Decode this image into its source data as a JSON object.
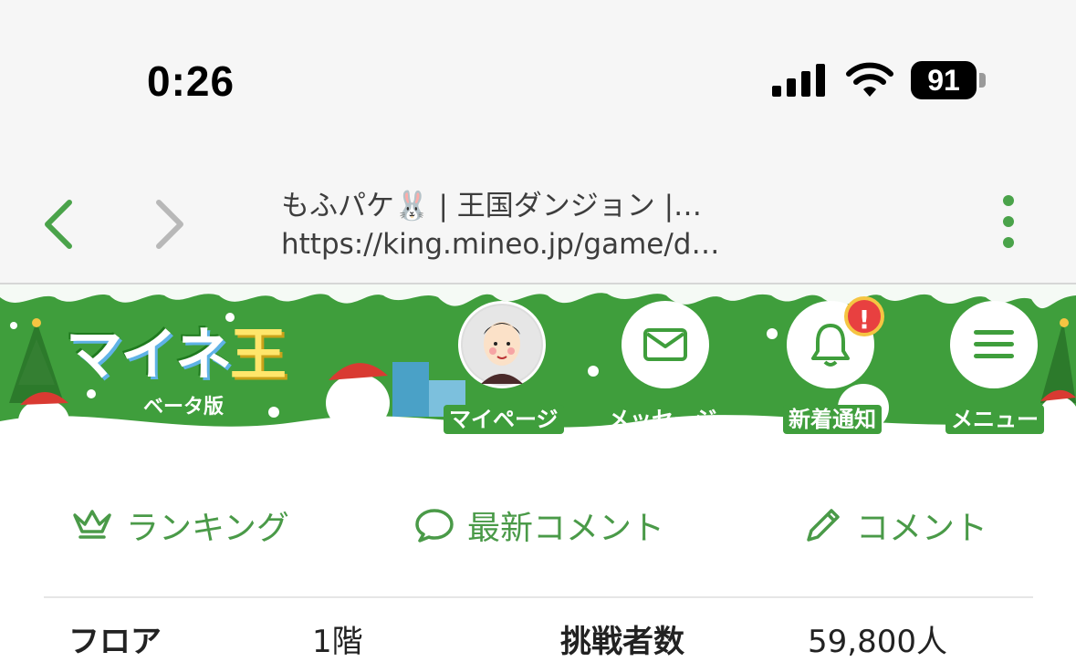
{
  "status": {
    "time": "0:26",
    "battery": "91"
  },
  "browser": {
    "title": "もふパケ🐰 | 王国ダンジョン |…",
    "url": "https://king.mineo.jp/game/d…",
    "icons": [
      "back-chevron-icon",
      "forward-chevron-icon",
      "more-vertical-icon"
    ]
  },
  "header": {
    "logo": {
      "text_main": "マイネ",
      "text_accent": "王",
      "sub": "ベータ版"
    },
    "buttons": [
      {
        "id": "mypage",
        "label": "マイページ",
        "icon": "avatar"
      },
      {
        "id": "messages",
        "label": "メッセージ",
        "icon": "envelope-icon"
      },
      {
        "id": "notifications",
        "label": "新着通知",
        "icon": "bell-icon",
        "badge": "!"
      },
      {
        "id": "menu",
        "label": "メニュー",
        "icon": "hamburger-icon"
      }
    ]
  },
  "tabs": [
    {
      "label": "ランキング",
      "icon": "crown-icon"
    },
    {
      "label": "最新コメント",
      "icon": "speech-bubble-icon"
    },
    {
      "label": "コメント",
      "icon": "pencil-icon"
    }
  ],
  "stats": {
    "floor_label": "フロア",
    "floor_value": "1階",
    "challengers_label": "挑戦者数",
    "challengers_value": "59,800人"
  },
  "colors": {
    "brand_green": "#3f9e3c",
    "link_green": "#4a9a48",
    "alert_red": "#e84040"
  }
}
